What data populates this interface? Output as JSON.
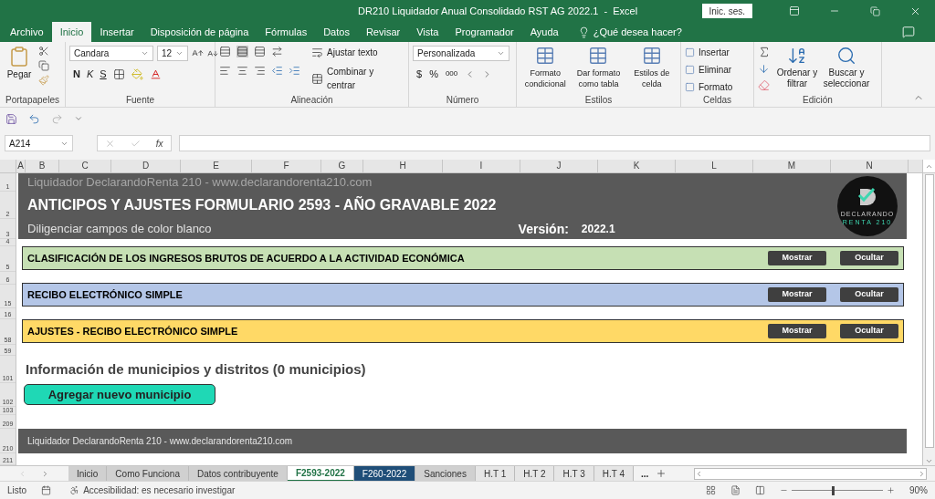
{
  "window": {
    "title": "DR210 Liquidador Anual Consolidado RST AG 2022.1  -  Excel",
    "sign_in": "Inic. ses."
  },
  "ribbon_tabs": [
    {
      "label": "Archivo",
      "selected": false
    },
    {
      "label": "Inicio",
      "selected": true
    },
    {
      "label": "Insertar",
      "selected": false
    },
    {
      "label": "Disposición de página",
      "selected": false
    },
    {
      "label": "Fórmulas",
      "selected": false
    },
    {
      "label": "Datos",
      "selected": false
    },
    {
      "label": "Revisar",
      "selected": false
    },
    {
      "label": "Vista",
      "selected": false
    },
    {
      "label": "Programador",
      "selected": false
    },
    {
      "label": "Ayuda",
      "selected": false
    }
  ],
  "tell_me": "¿Qué desea hacer?",
  "ribbon": {
    "clipboard": {
      "paste": "Pegar",
      "label": "Portapapeles"
    },
    "font": {
      "name": "Candara",
      "size": "12",
      "bold": "N",
      "italic": "K",
      "underline": "S",
      "label": "Fuente"
    },
    "alignment": {
      "wrap": "Ajustar texto",
      "merge": "Combinar y centrar",
      "label": "Alineación"
    },
    "number": {
      "format": "Personalizada",
      "currency": "$",
      "percent": "%",
      "thousands": "000",
      "label": "Número"
    },
    "styles": {
      "buttons": [
        "Formato condicional",
        "Dar formato como tabla",
        "Estilos de celda"
      ],
      "label": "Estilos"
    },
    "cells": {
      "buttons": [
        "Insertar",
        "Eliminar",
        "Formato"
      ],
      "label": "Celdas"
    },
    "editing": {
      "buttons": [
        "Ordenar y filtrar",
        "Buscar y seleccionar"
      ],
      "label": "Edición"
    }
  },
  "formula_bar": {
    "name_box": "A214",
    "fx": "fx"
  },
  "columns": [
    "A",
    "B",
    "C",
    "D",
    "E",
    "F",
    "G",
    "H",
    "I",
    "J",
    "K",
    "L",
    "M",
    "N"
  ],
  "row_numbers": [
    "1",
    "2",
    "3",
    "4",
    "5",
    "6",
    "15",
    "16",
    "58",
    "59",
    "101",
    "102",
    "103",
    "209",
    "210",
    "211"
  ],
  "header": {
    "site": "Liquidador DeclarandoRenta 210 - www.declarandorenta210.com",
    "title": "ANTICIPOS Y AJUSTES FORMULARIO 2593 - AÑO GRAVABLE 2022",
    "instruction": "Diligenciar campos de color blanco",
    "version_label": "Versión:",
    "version": "2022.1",
    "logo": [
      "DECLARANDO",
      "RENTA 210"
    ]
  },
  "sections": [
    {
      "title": "CLASIFICACIÓN DE LOS INGRESOS BRUTOS DE ACUERDO A LA ACTIVIDAD ECONÓMICA",
      "color": "#c6e0b4",
      "show": "Mostrar",
      "hide": "Ocultar"
    },
    {
      "title": "RECIBO ELECTRÓNICO SIMPLE",
      "color": "#b4c6e7",
      "show": "Mostrar",
      "hide": "Ocultar"
    },
    {
      "title": "AJUSTES  - RECIBO ELECTRÓNICO SIMPLE",
      "color": "#ffd966",
      "show": "Mostrar",
      "hide": "Ocultar"
    }
  ],
  "municipalities": {
    "heading": "Información de municipios y distritos (0 municipios)",
    "add_button": "Agregar nuevo municipio"
  },
  "footer": "Liquidador DeclarandoRenta 210 - www.declarandorenta210.com",
  "sheet_tabs": [
    {
      "label": "Inicio",
      "selected": false,
      "color": "#d0d0d0"
    },
    {
      "label": "Como Funciona",
      "selected": false,
      "color": "#d0d0d0"
    },
    {
      "label": "Datos contribuyente",
      "selected": false,
      "color": "#d0d0d0"
    },
    {
      "label": "F2593-2022",
      "selected": true
    },
    {
      "label": "F260-2022",
      "selected": false,
      "color": "#1f4e78"
    },
    {
      "label": "Sanciones",
      "selected": false,
      "color": "#d0d0d0"
    },
    {
      "label": "H.T 1",
      "selected": false,
      "color": "#e6e6e6"
    },
    {
      "label": "H.T 2",
      "selected": false,
      "color": "#e6e6e6"
    },
    {
      "label": "H.T 3",
      "selected": false,
      "color": "#e6e6e6"
    },
    {
      "label": "H.T 4",
      "selected": false,
      "color": "#e6e6e6"
    }
  ],
  "more_tabs": "...",
  "status_bar": {
    "mode": "Listo",
    "accessibility": "Accesibilidad: es necesario investigar",
    "zoom": "90%",
    "zoom_slider": {
      "level": 0.45
    }
  }
}
